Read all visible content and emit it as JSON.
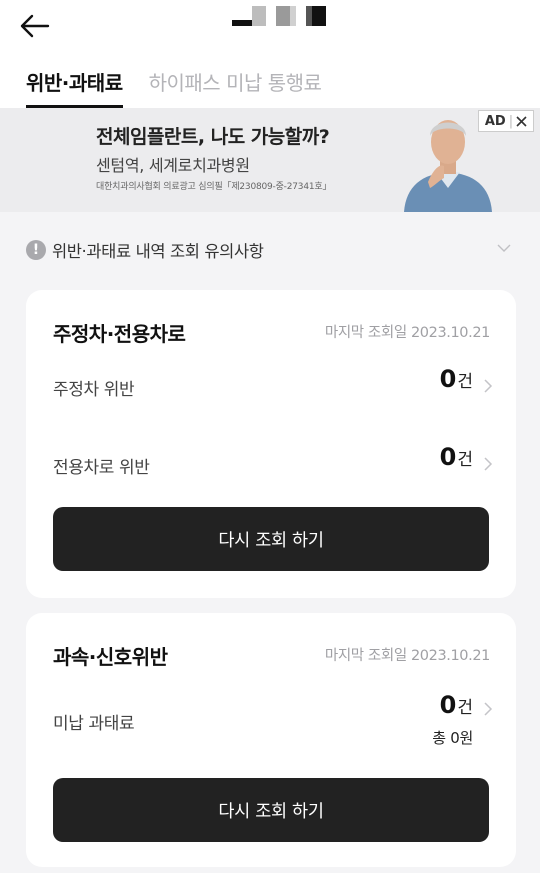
{
  "header": {
    "back_icon": "arrow-left-icon"
  },
  "tabs": [
    {
      "label": "위반·과태료",
      "active": true
    },
    {
      "label": "하이패스 미납 통행료",
      "active": false
    }
  ],
  "ad": {
    "title": "전체임플란트, 나도 가능할까?",
    "subtitle": "센텀역, 세계로치과병원",
    "note": "대한치과의사협회 의료광고 심의필「제230809-중-27341호」",
    "badge": "AD",
    "close_icon": "close-icon"
  },
  "notice": {
    "icon": "exclamation-icon",
    "text": "위반·과태료 내역 조회 유의사항",
    "chevron": "chevron-down-icon"
  },
  "cards": [
    {
      "title": "주정차·전용차로",
      "last_checked": "마지막 조회일 2023.10.21",
      "rows": [
        {
          "label": "주정차 위반",
          "count": "0",
          "unit": "건"
        },
        {
          "label": "전용차로 위반",
          "count": "0",
          "unit": "건"
        }
      ],
      "button": "다시 조회 하기"
    },
    {
      "title": "과속·신호위반",
      "last_checked": "마지막 조회일 2023.10.21",
      "rows": [
        {
          "label": "미납 과태료",
          "count": "0",
          "unit": "건",
          "sub": "총 0원"
        }
      ],
      "button": "다시 조회 하기"
    }
  ],
  "colors": {
    "background": "#f4f4f6",
    "card": "#ffffff",
    "button": "#222222",
    "muted": "#a0a0a4"
  }
}
